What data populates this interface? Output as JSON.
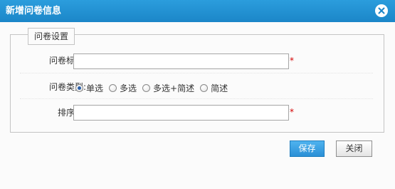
{
  "dialog": {
    "title": "新增问卷信息",
    "close_icon": "close-icon"
  },
  "form": {
    "legend": "问卷设置",
    "title_field": {
      "label": "问卷标题:",
      "value": "",
      "required_mark": "*"
    },
    "type_field": {
      "label": "问卷类型:",
      "options": [
        {
          "label": "单选",
          "checked": true
        },
        {
          "label": "多选",
          "checked": false
        },
        {
          "label": "多选+简述",
          "checked": false
        },
        {
          "label": "简述",
          "checked": false
        }
      ]
    },
    "order_field": {
      "label": "排序号:",
      "value": "",
      "required_mark": "*"
    }
  },
  "buttons": {
    "save": "保存",
    "close": "关闭"
  },
  "colors": {
    "titlebar": "#1f8fd3",
    "save_button": "#3a9fe2",
    "required": "#d40000"
  }
}
